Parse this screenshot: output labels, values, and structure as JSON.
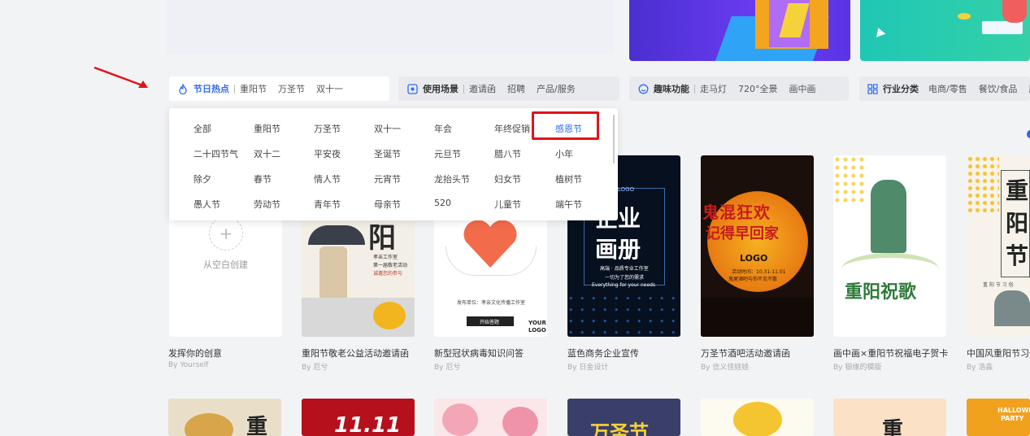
{
  "categories": [
    {
      "title": "节日热点",
      "icon": "flame-icon",
      "links": [
        "重阳节",
        "万圣节",
        "双十一"
      ]
    },
    {
      "title": "使用场景",
      "icon": "scene-icon",
      "links": [
        "邀请函",
        "招聘",
        "产品/服务"
      ]
    },
    {
      "title": "趣味功能",
      "icon": "smile-icon",
      "links": [
        "走马灯",
        "720°全景",
        "画中画"
      ]
    },
    {
      "title": "行业分类",
      "icon": "grid-icon",
      "links": [
        "电商/零售",
        "餐饮/食品",
        "服"
      ]
    }
  ],
  "dropdown": {
    "rows": [
      [
        "全部",
        "重阳节",
        "万圣节",
        "双十一",
        "年会",
        "年终促销",
        "感恩节"
      ],
      [
        "二十四节气",
        "双十二",
        "平安夜",
        "圣诞节",
        "元旦节",
        "腊八节",
        "小年"
      ],
      [
        "除夕",
        "春节",
        "情人节",
        "元宵节",
        "龙抬头节",
        "妇女节",
        "植树节"
      ],
      [
        "愚人节",
        "劳动节",
        "青年节",
        "母亲节",
        "520",
        "儿童节",
        "端午节"
      ]
    ],
    "highlighted": "感恩节"
  },
  "blank_card": {
    "plus": "+",
    "label": "从空白创建",
    "title": "发挥你的创意",
    "author": "By Yourself"
  },
  "cards": [
    {
      "title": "重阳节敬老公益活动邀请函",
      "author": "By 厄兮",
      "texts": [
        "阳",
        "孝亲工作室",
        "第一届敬老活动",
        "诚邀您的参与"
      ]
    },
    {
      "title": "新型冠状病毒知识问答",
      "author": "By 厄兮",
      "texts": [
        "发布单位：孝亲文化传播工作室",
        "开始答题",
        "YOUR",
        "LOGO"
      ]
    },
    {
      "title": "蓝色商务企业宣传",
      "author": "By 日金设计",
      "texts": [
        "企业",
        "画册",
        "LOGO",
        "高端 · 品质专业工作室",
        "一切为了您的需求",
        "Everything for your needs"
      ]
    },
    {
      "title": "万圣节酒吧活动邀请函",
      "author": "By 信义佳娃娃",
      "texts": [
        "鬼混狂欢",
        "记得早回家",
        "LOGO",
        "活动时间：10.31-11.01",
        "鬼屋酒吧与你不见不散"
      ]
    },
    {
      "title": "画中画×重阳节祝福电子贺卡",
      "author": "By 银缘的模版",
      "texts": [
        "重阳祝歌"
      ]
    },
    {
      "title": "中国风重阳节习俗",
      "author": "By 浩淼",
      "texts": [
        "重",
        "阳",
        "节",
        "重 阳 节 习 俗"
      ]
    }
  ],
  "row2": [
    {
      "texts": [
        "重"
      ]
    },
    {
      "texts": [
        "11.11"
      ]
    },
    {
      "texts": []
    },
    {
      "texts": [
        "万圣节"
      ]
    },
    {
      "texts": []
    },
    {
      "texts": [
        "重"
      ]
    },
    {
      "texts": [
        "HALLOWE",
        "PARTY"
      ]
    }
  ],
  "colors": {
    "accent": "#2f6bf0",
    "highlight_box": "#e0131a"
  }
}
